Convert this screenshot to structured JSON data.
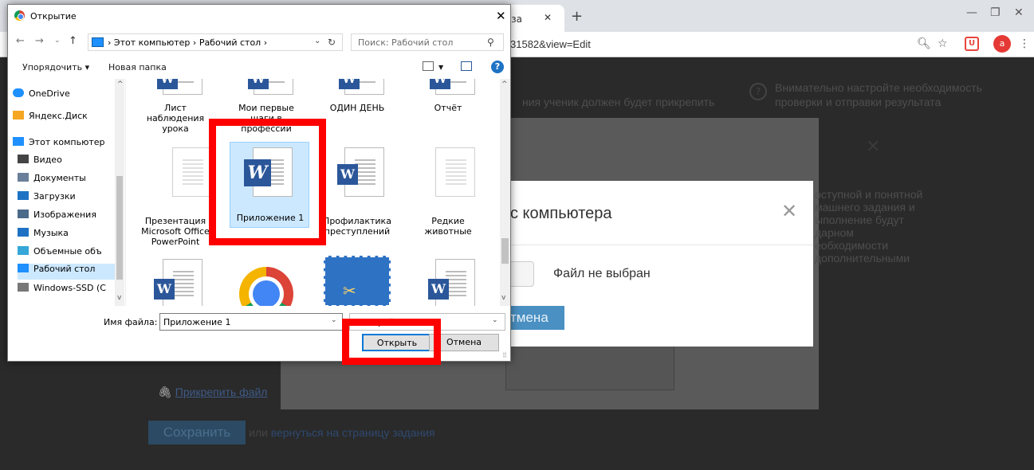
{
  "browser": {
    "tab_title": "е за",
    "url": "31582&view=Edit",
    "avatar_letter": "a",
    "new_tab": "+",
    "close": "✕"
  },
  "page": {
    "help_text_1": "Внимательно настройте необходимость",
    "help_text_2": "проверки и отправки результата",
    "hint_text": "ния ученик должен будет прикрепить",
    "side_text": [
      "оступной и понятной",
      "машнего задания и",
      "ыполнение будут",
      "дарном",
      "еобходимости",
      "дополнительными"
    ],
    "attach_link": "Прикрепить файл",
    "save_button": "Сохранить",
    "or_text": "или",
    "back_link": "вернуться на страницу задания"
  },
  "upload_modal": {
    "title": "с компьютера",
    "file_status": "Файл не выбран",
    "cancel": "тмена"
  },
  "dialog": {
    "title": "Открытие",
    "path_pc": "Этот компьютер",
    "path_folder": "Рабочий стол",
    "search_placeholder": "Поиск: Рабочий стол",
    "organize": "Упорядочить ▾",
    "new_folder": "Новая папка",
    "nav_items": [
      {
        "label": "OneDrive",
        "color": "#1e90ff"
      },
      {
        "label": "Яндекс.Диск",
        "color": "#f5a623"
      },
      {
        "label": "Этот компьютер",
        "color": "#1e90ff"
      },
      {
        "label": "Видео",
        "color": "#444"
      },
      {
        "label": "Документы",
        "color": "#6a7f99"
      },
      {
        "label": "Загрузки",
        "color": "#1e72c4"
      },
      {
        "label": "Изображения",
        "color": "#4a6a8a"
      },
      {
        "label": "Музыка",
        "color": "#1e72c4"
      },
      {
        "label": "Объемные объ",
        "color": "#35a7d8"
      },
      {
        "label": "Рабочий стол",
        "color": "#1e90ff"
      },
      {
        "label": "Windows-SSD (C",
        "color": "#777"
      }
    ],
    "files": [
      {
        "label": "Лист наблюдения урока",
        "icon": "word"
      },
      {
        "label": "Мои первые шаги в профессии",
        "icon": "word"
      },
      {
        "label": "ОДИН ДЕНЬ",
        "icon": "word"
      },
      {
        "label": "Отчёт",
        "icon": "word"
      },
      {
        "label": "Презентация Microsoft Office PowerPoint",
        "icon": "blank"
      },
      {
        "label": "Приложение 1",
        "icon": "word-selected"
      },
      {
        "label": "Профилактика преступлений",
        "icon": "word"
      },
      {
        "label": "Редкие животные",
        "icon": "blank"
      },
      {
        "label": "",
        "icon": "word"
      },
      {
        "label": "",
        "icon": "chrome"
      },
      {
        "label": "",
        "icon": "snip"
      },
      {
        "label": "",
        "icon": "word"
      }
    ],
    "filename_label": "Имя файла:",
    "filename_value": "Приложение 1",
    "filter_value": "Все файлы",
    "open_button": "Открыть",
    "cancel_button": "Отмена"
  },
  "colors": {
    "highlight": "#ff0000",
    "selection": "#cce8ff",
    "word_blue": "#2b579a"
  }
}
